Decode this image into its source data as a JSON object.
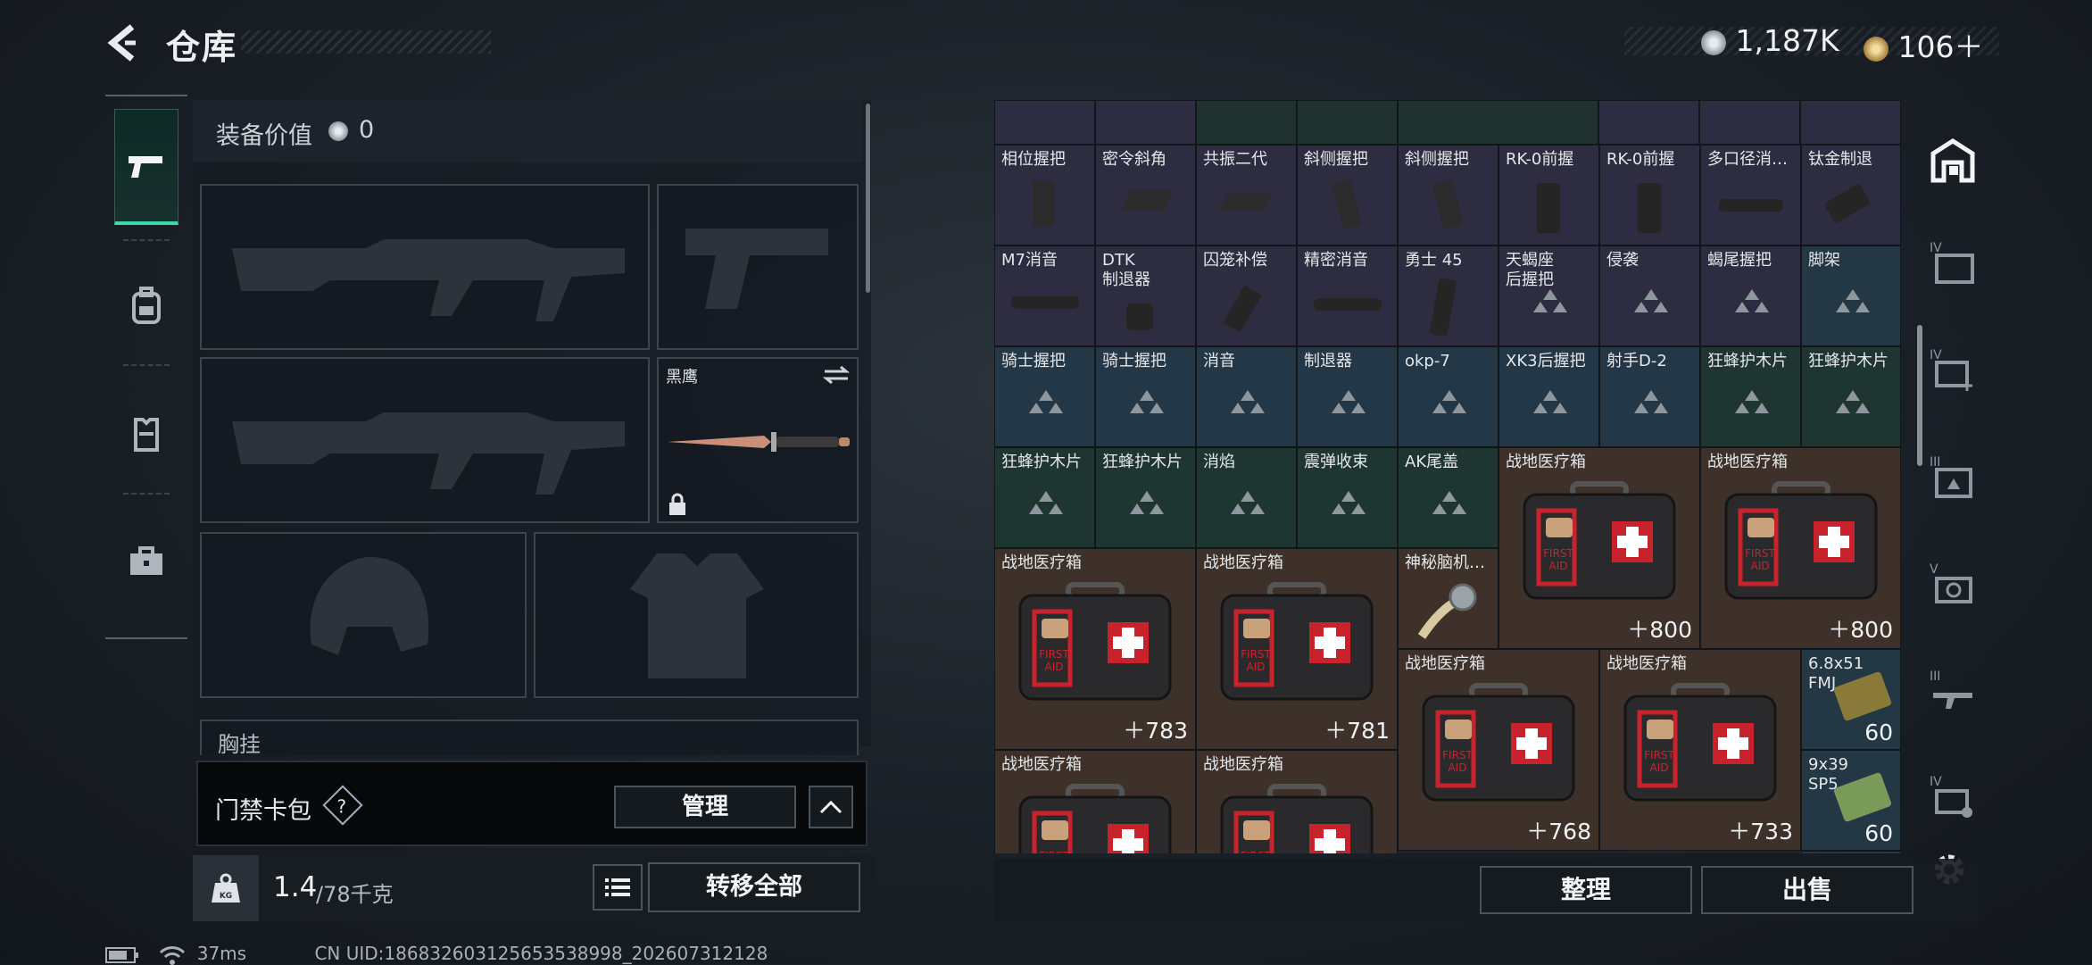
{
  "header": {
    "title": "仓库",
    "currency1": "1,187K",
    "currency2": "106＋",
    "colors": {
      "accent_green": "#3ed9a8",
      "coin_silver": "#c9ced3",
      "coin_gold": "#d7b46a"
    }
  },
  "left_tabs": [
    {
      "icon": "pistol-icon",
      "active": true
    },
    {
      "icon": "backpack-icon",
      "active": false
    },
    {
      "icon": "vest-icon",
      "active": false
    },
    {
      "icon": "case-icon",
      "active": false
    }
  ],
  "equipment": {
    "value_label": "装备价值",
    "value": "0",
    "knife_name": "黑鹰",
    "chest_label": "胸挂"
  },
  "card_pack": {
    "label": "门禁卡包",
    "help": "?",
    "manage": "管理"
  },
  "weight": {
    "current": "1.4",
    "max": "/78千克",
    "kg_icon": "KG",
    "transfer_all": "转移全部"
  },
  "inventory": {
    "row1": [
      "相位握把",
      "密令斜角",
      "共振二代",
      "斜侧握把",
      "斜侧握把",
      "RK-0前握",
      "RK-0前握",
      "多口径消…",
      "钛金制退"
    ],
    "row2": [
      "M7消音",
      "DTK\n制退器",
      "囚笼补偿",
      "精密消音",
      "勇士 45",
      "天蝎座\n后握把",
      "侵袭",
      "蝎尾握把",
      "脚架"
    ],
    "row3": [
      "骑士握把",
      "骑士握把",
      "消音",
      "制退器",
      "okp-7",
      "XK3后握把",
      "射手D-2",
      "狂蜂护木片",
      "狂蜂护木片"
    ],
    "row4": [
      "狂蜂护木片",
      "狂蜂护木片",
      "消焰",
      "震弹收束",
      "AK尾盖"
    ],
    "med_name": "战地医疗箱",
    "med_counts": [
      "＋800",
      "＋800",
      "＋783",
      "＋781",
      "＋768",
      "＋733"
    ],
    "watch_name": "神秘脑机…",
    "ammo1": {
      "name": "6.8x51\nFMJ",
      "count": "60"
    },
    "ammo2": {
      "name": "9x39\nSP5",
      "count": "60"
    },
    "aid_text": "FIRST\nAID"
  },
  "bottom": {
    "sort": "整理",
    "sell": "出售"
  },
  "right_tabs": [
    "IV",
    "IV",
    "III",
    "V",
    "III",
    "IV"
  ],
  "status": {
    "ping": "37ms",
    "uid": "CN UID:186832603125653538998_202607312128"
  }
}
